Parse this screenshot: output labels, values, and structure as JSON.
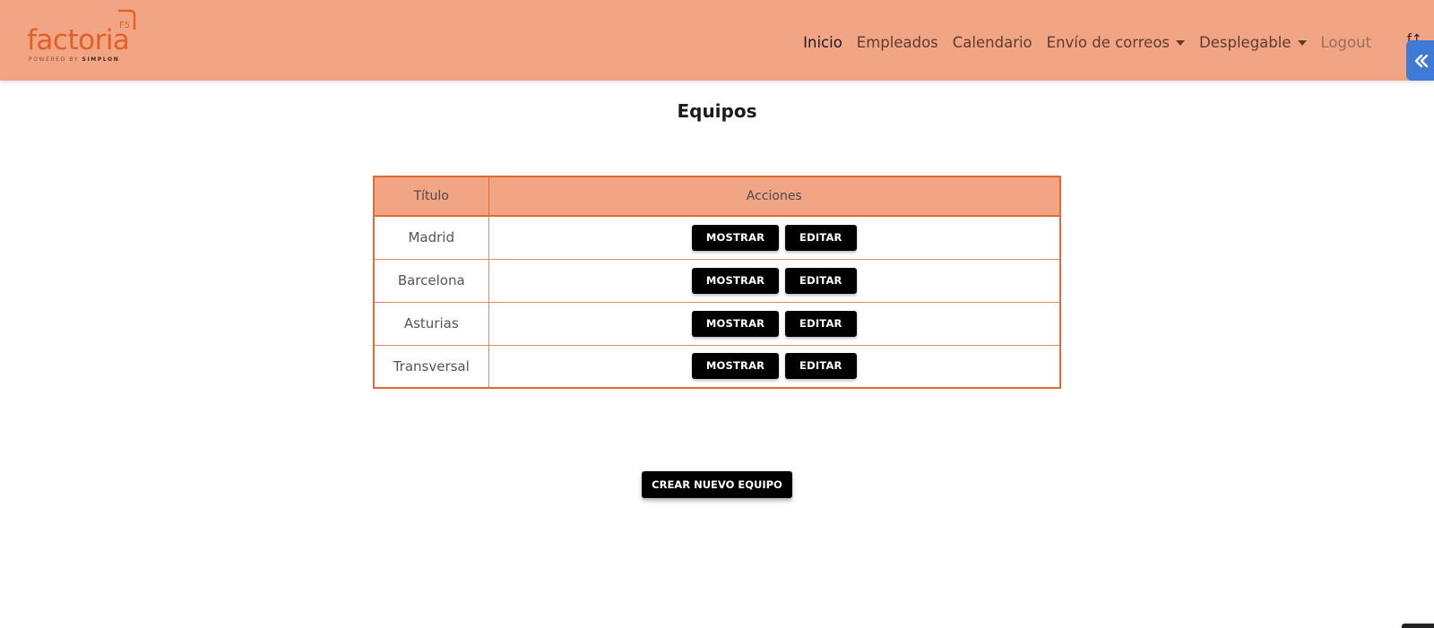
{
  "brand": {
    "name": "factoria",
    "tagline_prefix": "POWERED BY",
    "tagline_brand": "SIMPLON",
    "badge": "F5",
    "color": "#e06027"
  },
  "nav": {
    "items": [
      {
        "label": "Inicio",
        "state": "active"
      },
      {
        "label": "Empleados"
      },
      {
        "label": "Calendario"
      },
      {
        "label": "Envío de correos",
        "dropdown": true
      },
      {
        "label": "Desplegable",
        "dropdown": true
      },
      {
        "label": "Logout",
        "state": "muted"
      }
    ],
    "trailing_glyph": "f↑",
    "side_toggle_icon": "double-chevron-left-icon"
  },
  "page": {
    "title": "Equipos"
  },
  "table": {
    "headers": [
      "Título",
      "Acciones"
    ],
    "rows": [
      {
        "title": "Madrid",
        "show": "MOSTRAR",
        "edit": "EDITAR"
      },
      {
        "title": "Barcelona",
        "show": "MOSTRAR",
        "edit": "EDITAR"
      },
      {
        "title": "Asturias",
        "show": "MOSTRAR",
        "edit": "EDITAR"
      },
      {
        "title": "Transversal",
        "show": "MOSTRAR",
        "edit": "EDITAR"
      }
    ]
  },
  "actions": {
    "create_label": "CREAR NUEVO EQUIPO"
  },
  "colors": {
    "navbar": "#f2a585",
    "table_border": "#e06a33",
    "button": "#000000",
    "side_toggle": "#3f7bd6"
  }
}
